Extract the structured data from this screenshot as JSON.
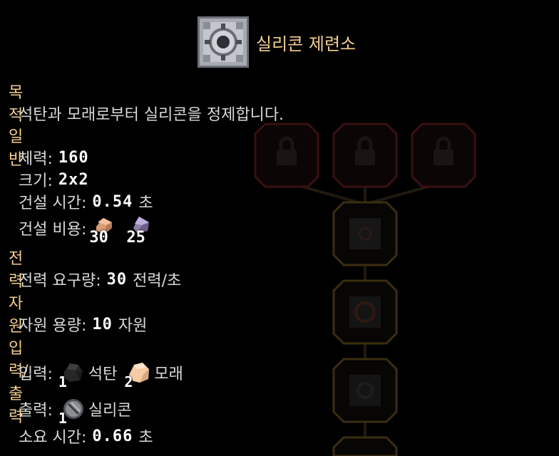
{
  "block": {
    "name": "실리콘 제련소"
  },
  "sections": {
    "purpose": {
      "title": "목적",
      "description": "석탄과 모래로부터 실리콘을 정제합니다."
    },
    "general": {
      "title": "일반",
      "health_label": "체력:",
      "health_value": "160",
      "size_label": "크기:",
      "size_value": "2x2",
      "build_time_label": "건설 시간:",
      "build_time_value": "0.54",
      "build_time_unit": "초",
      "build_cost_label": "건설 비용:",
      "build_cost": [
        {
          "icon": "copper-icon",
          "amount": "30",
          "color": "#d99d73"
        },
        {
          "icon": "lead-icon",
          "amount": "25",
          "color": "#8c7fa9"
        }
      ]
    },
    "power": {
      "title": "전력",
      "use_label": "전력 요구량:",
      "use_value": "30",
      "use_unit": "전력/초"
    },
    "items": {
      "title": "자원",
      "capacity_label": "자원 용량:",
      "capacity_value": "10",
      "capacity_unit": "자원"
    },
    "crafting": {
      "title": "입력/출력",
      "input_label": "입력:",
      "inputs": [
        {
          "icon": "coal-icon",
          "amount": "1",
          "name": "석탄",
          "color": "#272727"
        },
        {
          "icon": "sand-icon",
          "amount": "2",
          "name": "모래",
          "color": "#f7cba4"
        }
      ],
      "output_label": "출력:",
      "outputs": [
        {
          "icon": "silicon-icon",
          "amount": "1",
          "name": "실리콘",
          "color": "#53565c"
        }
      ],
      "time_label": "소요 시간:",
      "time_value": "0.66",
      "time_unit": "초"
    }
  },
  "colors": {
    "accent": "#f3cf8e",
    "locked_node_border": "#5a1616",
    "tree_node_border": "#4a3a14"
  }
}
